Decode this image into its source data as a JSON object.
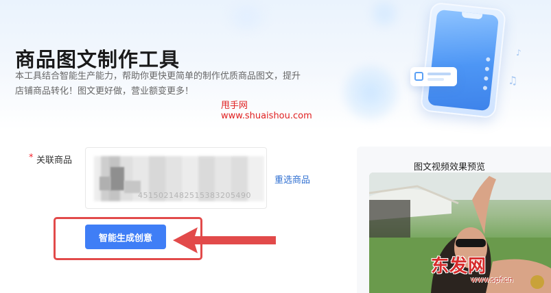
{
  "header": {
    "title": "商品图文制作工具",
    "description": "本工具结合智能生产能力，帮助你更快更简单的制作优质商品图文，提升店铺商品转化！图文更好做，营业额变更多！"
  },
  "watermark": {
    "name": "甩手网",
    "url": "www.shuaishou.com",
    "logo_text": "东发网",
    "logo_url": "www.spf.cn"
  },
  "form": {
    "required_mark": "*",
    "product_label": "关联商品",
    "product_id": "4515021482515383205490",
    "reselect_label": "重选商品",
    "generate_button": "智能生成创意"
  },
  "preview": {
    "title": "图文视频效果预览"
  },
  "colors": {
    "accent": "#3f7ef6",
    "link": "#2f6fd1",
    "highlight": "#e24a4a",
    "watermark": "#e02020"
  }
}
